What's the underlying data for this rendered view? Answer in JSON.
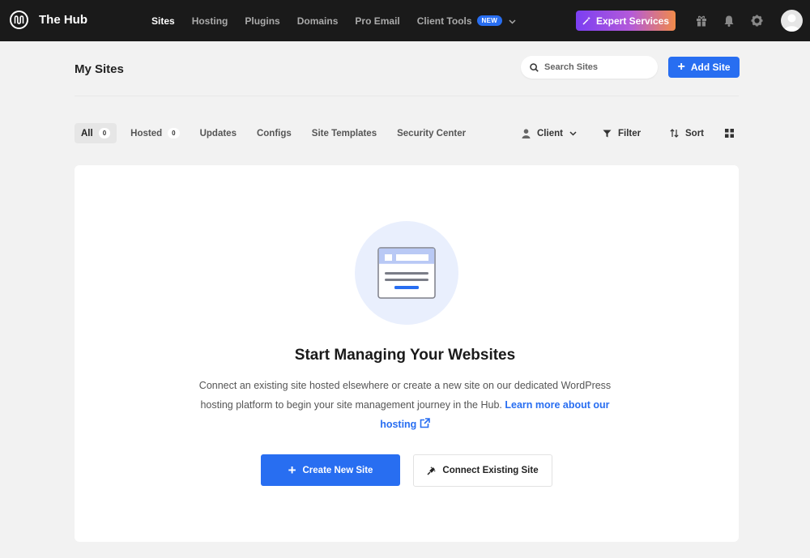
{
  "topbar": {
    "brand": "The Hub",
    "nav": [
      {
        "label": "Sites",
        "active": true
      },
      {
        "label": "Hosting"
      },
      {
        "label": "Plugins"
      },
      {
        "label": "Domains"
      },
      {
        "label": "Pro Email"
      },
      {
        "label": "Client Tools",
        "badge": "NEW"
      }
    ],
    "expert_label": "Expert Services"
  },
  "header": {
    "title": "My Sites",
    "search_placeholder": "Search Sites",
    "add_site_label": "Add Site"
  },
  "tabs": [
    {
      "label": "All",
      "count": "0"
    },
    {
      "label": "Hosted",
      "count": "0"
    },
    {
      "label": "Updates"
    },
    {
      "label": "Configs"
    },
    {
      "label": "Site Templates"
    },
    {
      "label": "Security Center"
    }
  ],
  "toolbar": {
    "client_label": "Client",
    "filter_label": "Filter",
    "sort_label": "Sort"
  },
  "empty": {
    "title": "Start Managing Your Websites",
    "desc": "Connect an existing site hosted elsewhere or create a new site on our dedicated WordPress hosting platform to begin your site management journey in the Hub.",
    "link": "Learn more about our hosting",
    "create_label": "Create New Site",
    "connect_label": "Connect Existing Site"
  },
  "colors": {
    "topbar": "#1a1a1a",
    "accent": "#286ef1",
    "background": "#f2f2f2"
  },
  "icons": [
    "hub-logo-icon",
    "chevron-down-icon",
    "wand-icon",
    "gift-icon",
    "bell-icon",
    "gear-icon",
    "search-icon",
    "person-icon",
    "filter-icon",
    "sort-icon",
    "grid-view-icon",
    "plug-icon",
    "external-link-icon"
  ]
}
